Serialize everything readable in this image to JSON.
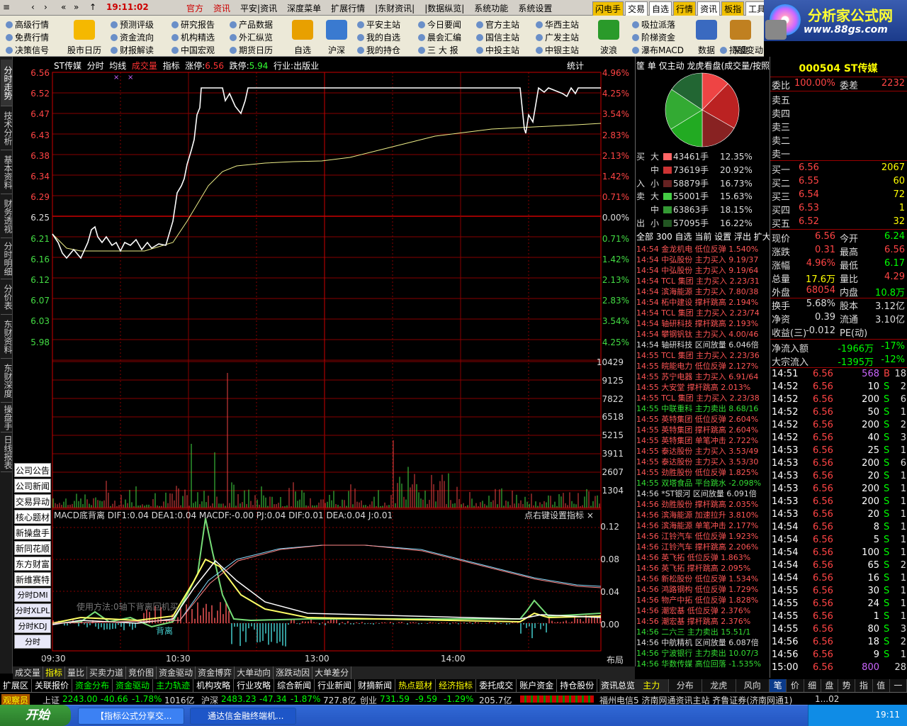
{
  "topbar": {
    "clock": "19:11:02",
    "menu": [
      "官方",
      "资讯",
      "平安|资讯",
      "深度菜单",
      "扩展行情",
      "|东财资讯|",
      "|数据纵览|",
      "系统功能",
      "系统设置"
    ],
    "quick": [
      "闪电手",
      "交易",
      "自选",
      "行情",
      "资讯",
      "板指",
      "工具"
    ]
  },
  "logo": {
    "line1": "分析家公式网",
    "line2": "www.88gs.com"
  },
  "toolbar": {
    "col1": [
      "高级行情",
      "免费行情",
      "决策信号"
    ],
    "big1": "股市日历",
    "col2": [
      "预测评级",
      "资金流向",
      "财报解读"
    ],
    "col3": [
      "研究报告",
      "机构精选",
      "中国宏观"
    ],
    "col4": [
      "产品数据",
      "外汇纵览",
      "期货日历"
    ],
    "big2": "自选",
    "big3": "沪深",
    "col5": [
      "平安主站",
      "我的自选",
      "我的持仓"
    ],
    "col6": [
      "今日要闻",
      "晨会汇编",
      "三 大 报"
    ],
    "col7": [
      "官方主站",
      "国信主站",
      "中投主站"
    ],
    "col8": [
      "华西主站",
      "广发主站",
      "中银主站"
    ],
    "big4": "波浪",
    "col9": [
      "吸拉派落",
      "阶梯资金",
      "瀑布MACD"
    ],
    "big5": "数据",
    "big6": "深度",
    "big7": "纵比",
    "col10": [
      "",
      "",
      "持股变动"
    ]
  },
  "lefttabs": [
    "分时走势",
    "技术分析",
    "基本资料",
    "财务透视",
    "分时明细",
    "分价表",
    "东财资料",
    "东财深度",
    "操盘手",
    "日线报表"
  ],
  "chart_title": {
    "name": "ST传媒",
    "tabs": [
      "分时",
      "均线",
      "成交量",
      "指标"
    ],
    "zt_label": "涨停:",
    "zt": "6.56",
    "dt_label": "跌停:",
    "dt": "5.94",
    "industry": "行业:出版业"
  },
  "stat_label": "统计",
  "price_axis": {
    "left": [
      "6.56",
      "6.52",
      "6.47",
      "6.43",
      "6.38",
      "6.34",
      "6.29",
      "6.25",
      "6.21",
      "6.16",
      "6.12",
      "6.07",
      "6.03",
      "5.98"
    ],
    "right": [
      "4.96%",
      "4.25%",
      "3.54%",
      "2.83%",
      "2.13%",
      "1.42%",
      "0.71%",
      "0.00%",
      "0.71%",
      "1.42%",
      "2.13%",
      "2.83%",
      "3.54%",
      "4.25%"
    ]
  },
  "vol_axis": [
    "10429",
    "9125",
    "7822",
    "6518",
    "5215",
    "3911",
    "2607",
    "1304"
  ],
  "macd_axis": [
    "0.12",
    "0.08",
    "0.04",
    "0.00"
  ],
  "left_buttons": [
    "公司公告",
    "公司新闻",
    "交易异动",
    "核心题材",
    "新操盘手",
    "新同花顺",
    "东方财富",
    "新维赛特",
    "分时DMI",
    "分时XLPL",
    "分时KDJ",
    "分时MACD"
  ],
  "macd": {
    "title": "MACD底背离  DIF1:0.04  DEA1:0.04  MACDF:-0.00  PJ:0.04  DIF:0.01  DEA:0.04  J:0.01",
    "hint": "点右键设置指标",
    "note": "使用方法:0轴下背离回机买",
    "tag": "背离"
  },
  "x_axis": [
    "09:30",
    "10:30",
    "13:00",
    "14:00"
  ],
  "bujuLabel": "布局",
  "bottom_tabs": [
    "成交量",
    "指标",
    "量比",
    "买卖力道",
    "竞价图",
    "资金驱动",
    "资金博弈",
    "大单动向",
    "涨跌动因",
    "大单差分"
  ],
  "tabs2": [
    "扩展区",
    "关联报价",
    "资金分布",
    "资金驱动",
    "主力轨迹",
    "机构攻略",
    "行业攻略",
    "综合新闻",
    "行业新闻",
    "财摘新闻",
    "热点题材",
    "经济指标",
    "委托成交",
    "账户资金",
    "持仓股份"
  ],
  "mid": {
    "head": "筐 单 仅主动 龙虎看盘(成交量/按照",
    "pie_colors": [
      "#d33",
      "#b22",
      "#822",
      "#2a2",
      "#3a3",
      "#263"
    ],
    "buy_rows": [
      {
        "g": "大",
        "v": "43461手",
        "p": "12.35%",
        "c": "#f66"
      },
      {
        "g": "中",
        "v": "73619手",
        "p": "20.92%",
        "c": "#c33"
      },
      {
        "g": "小",
        "v": "58879手",
        "p": "16.73%",
        "c": "#622"
      }
    ],
    "sell_rows": [
      {
        "g": "大",
        "v": "55001手",
        "p": "15.63%",
        "c": "#4c4"
      },
      {
        "g": "中",
        "v": "63863手",
        "p": "18.15%",
        "c": "#393"
      },
      {
        "g": "小",
        "v": "57095手",
        "p": "16.22%",
        "c": "#252"
      }
    ],
    "buy_label": [
      "买",
      "入"
    ],
    "sell_label": [
      "卖",
      "出"
    ],
    "flow_head": "全部 300 自选 当前 设置 浮出 扩大",
    "flow": [
      [
        "14:54",
        "金龙机电",
        "低位反弹",
        "1.540%",
        "r"
      ],
      [
        "14:54",
        "中弘股份",
        "主力买入",
        "9.19/37",
        "r"
      ],
      [
        "14:54",
        "中弘股份",
        "主力买入",
        "9.19/64",
        "r"
      ],
      [
        "14:54",
        "TCL 集团",
        "主力买入",
        "2.23/31",
        "r"
      ],
      [
        "14:54",
        "滨海能源",
        "主力买入",
        "7.80/38",
        "r"
      ],
      [
        "14:54",
        "柘中建设",
        "撑杆跳高",
        "2.194%",
        "r"
      ],
      [
        "14:54",
        "TCL 集团",
        "主力买入",
        "2.23/74",
        "r"
      ],
      [
        "14:54",
        "轴研科技",
        "撑杆跳高",
        "2.193%",
        "r"
      ],
      [
        "14:54",
        "攀钢钒钛",
        "主力买入",
        "4.00/46",
        "r"
      ],
      [
        "14:54",
        "轴研科技",
        "区间放量",
        "6.046倍",
        "w"
      ],
      [
        "14:55",
        "TCL 集团",
        "主力买入",
        "2.23/36",
        "r"
      ],
      [
        "14:55",
        "皖能电力",
        "低位反弹",
        "2.127%",
        "r"
      ],
      [
        "14:55",
        "苏宁电器",
        "主力买入",
        "6.91/64",
        "r"
      ],
      [
        "14:55",
        "大安堂",
        "撑杆跳高",
        "2.013%",
        "r"
      ],
      [
        "14:55",
        "TCL 集团",
        "主力买入",
        "2.23/38",
        "r"
      ],
      [
        "14:55",
        "中联重科",
        "主力卖出",
        "8.68/16",
        "g"
      ],
      [
        "14:55",
        "英特集团",
        "低位反弹",
        "2.604%",
        "r"
      ],
      [
        "14:55",
        "英特集团",
        "撑杆跳高",
        "2.604%",
        "r"
      ],
      [
        "14:55",
        "英特集团",
        "单笔冲击",
        "2.722%",
        "r"
      ],
      [
        "14:55",
        "泰达股份",
        "主力买入",
        "3.53/49",
        "r"
      ],
      [
        "14:55",
        "泰达股份",
        "主力买入",
        "3.53/30",
        "r"
      ],
      [
        "14:55",
        "劲胜股份",
        "低位反弹",
        "1.825%",
        "r"
      ],
      [
        "14:55",
        "双塔食品",
        "平台跳水",
        "-2.098%",
        "g"
      ],
      [
        "14:56",
        "*ST银河",
        "区间放量",
        "6.091倍",
        "w"
      ],
      [
        "14:56",
        "劲胜股份",
        "撑杆跳高",
        "2.035%",
        "r"
      ],
      [
        "14:56",
        "滨海能源",
        "加速拉升",
        "3.810%",
        "r"
      ],
      [
        "14:56",
        "滨海能源",
        "单笔冲击",
        "2.177%",
        "r"
      ],
      [
        "14:56",
        "江铃汽车",
        "低位反弹",
        "1.923%",
        "r"
      ],
      [
        "14:56",
        "江铃汽车",
        "撑杆跳高",
        "2.206%",
        "r"
      ],
      [
        "14:56",
        "英飞拓",
        "低位反弹",
        "1.863%",
        "r"
      ],
      [
        "14:56",
        "英飞拓",
        "撑杆跳高",
        "2.095%",
        "r"
      ],
      [
        "14:56",
        "新松股份",
        "低位反弹",
        "1.534%",
        "r"
      ],
      [
        "14:56",
        "鸿路钢构",
        "低位反弹",
        "1.729%",
        "r"
      ],
      [
        "14:56",
        "物产中拓",
        "低位反弹",
        "1.828%",
        "r"
      ],
      [
        "14:56",
        "潮宏基",
        "低位反弹",
        "2.376%",
        "r"
      ],
      [
        "14:56",
        "潮宏基",
        "撑杆跳高",
        "2.376%",
        "r"
      ],
      [
        "14:56",
        "二六三",
        "主力卖出",
        "15.51/1",
        "g"
      ],
      [
        "14:56",
        "中航精机",
        "区间放量",
        "6.087倍",
        "w"
      ],
      [
        "14:56",
        "宁波银行",
        "主力卖出",
        "10.07/3",
        "g"
      ],
      [
        "14:56",
        "华数传媒",
        "高位回落",
        "-1.535%",
        "g"
      ]
    ],
    "tabs": [
      "主力",
      "分布",
      "龙虎",
      "风向"
    ],
    "xunzong": "资讯总览"
  },
  "right": {
    "code": "000504 ST传媒",
    "wb": {
      "l1": "委比",
      "v1": "100.00%",
      "l2": "委差",
      "v2": "2232"
    },
    "sells": [
      "卖五",
      "卖四",
      "卖三",
      "卖二",
      "卖一"
    ],
    "buys": [
      {
        "l": "买一",
        "p": "6.56",
        "v": "2067"
      },
      {
        "l": "买二",
        "p": "6.55",
        "v": "60"
      },
      {
        "l": "买三",
        "p": "6.54",
        "v": "72"
      },
      {
        "l": "买四",
        "p": "6.53",
        "v": "1"
      },
      {
        "l": "买五",
        "p": "6.52",
        "v": "32"
      }
    ],
    "quote": [
      {
        "l": "现价",
        "v": "6.56",
        "c": "#f44",
        "l2": "今开",
        "v2": "6.24",
        "c2": "#0f0"
      },
      {
        "l": "涨跌",
        "v": "0.31",
        "c": "#f44",
        "l2": "最高",
        "v2": "6.56",
        "c2": "#f44"
      },
      {
        "l": "涨幅",
        "v": "4.96%",
        "c": "#f44",
        "l2": "最低",
        "v2": "6.17",
        "c2": "#0f0"
      },
      {
        "l": "总量",
        "v": "17.6万",
        "c": "#ff0",
        "l2": "量比",
        "v2": "4.29",
        "c2": "#f44"
      },
      {
        "l": "外盘",
        "v": "68054",
        "c": "#f44",
        "l2": "内盘",
        "v2": "10.8万",
        "c2": "#0f0"
      },
      {
        "l": "换手",
        "v": "5.68%",
        "c": "#ddd",
        "l2": "股本",
        "v2": "3.12亿",
        "c2": "#ddd"
      },
      {
        "l": "净资",
        "v": "0.39",
        "c": "#ddd",
        "l2": "流通",
        "v2": "3.10亿",
        "c2": "#ddd"
      },
      {
        "l": "收益(三)",
        "v": "-0.012",
        "c": "#ddd",
        "l2": "PE(动)",
        "v2": "",
        "c2": "#ddd"
      }
    ],
    "flow": [
      {
        "l": "净流入额",
        "v": "-1966万",
        "p": "-17%"
      },
      {
        "l": "大宗流入",
        "v": "-1395万",
        "p": "-12%"
      }
    ],
    "trades": [
      [
        "14:51",
        "6.56",
        "568",
        "B",
        "18",
        "#c6f"
      ],
      [
        "14:52",
        "6.56",
        "10",
        "S",
        "2",
        "#fff"
      ],
      [
        "14:52",
        "6.56",
        "200",
        "S",
        "6",
        "#fff"
      ],
      [
        "14:52",
        "6.56",
        "50",
        "S",
        "1",
        "#fff"
      ],
      [
        "14:52",
        "6.56",
        "200",
        "S",
        "2",
        "#fff"
      ],
      [
        "14:52",
        "6.56",
        "40",
        "S",
        "3",
        "#fff"
      ],
      [
        "14:53",
        "6.56",
        "25",
        "S",
        "1",
        "#fff"
      ],
      [
        "14:53",
        "6.56",
        "200",
        "S",
        "6",
        "#fff"
      ],
      [
        "14:53",
        "6.56",
        "20",
        "S",
        "1",
        "#fff"
      ],
      [
        "14:53",
        "6.56",
        "200",
        "S",
        "1",
        "#fff"
      ],
      [
        "14:53",
        "6.56",
        "200",
        "S",
        "1",
        "#fff"
      ],
      [
        "14:53",
        "6.56",
        "20",
        "S",
        "1",
        "#fff"
      ],
      [
        "14:54",
        "6.56",
        "8",
        "S",
        "1",
        "#fff"
      ],
      [
        "14:54",
        "6.56",
        "5",
        "S",
        "1",
        "#fff"
      ],
      [
        "14:54",
        "6.56",
        "100",
        "S",
        "1",
        "#fff"
      ],
      [
        "14:54",
        "6.56",
        "65",
        "S",
        "2",
        "#fff"
      ],
      [
        "14:54",
        "6.56",
        "16",
        "S",
        "1",
        "#fff"
      ],
      [
        "14:55",
        "6.56",
        "30",
        "S",
        "1",
        "#fff"
      ],
      [
        "14:55",
        "6.56",
        "24",
        "S",
        "1",
        "#fff"
      ],
      [
        "14:55",
        "6.56",
        "1",
        "S",
        "1",
        "#fff"
      ],
      [
        "14:55",
        "6.56",
        "80",
        "S",
        "3",
        "#fff"
      ],
      [
        "14:56",
        "6.56",
        "18",
        "S",
        "2",
        "#fff"
      ],
      [
        "14:56",
        "6.56",
        "9",
        "S",
        "1",
        "#fff"
      ],
      [
        "15:00",
        "6.56",
        "800",
        "",
        "28",
        "#c6f"
      ]
    ],
    "tabs": [
      "笔",
      "价",
      "细",
      "盘",
      "势",
      "指",
      "值",
      "一"
    ]
  },
  "status": {
    "user": "观察员",
    "sh": "上证",
    "sh_v": "2243.00",
    "sh_c": "-40.66",
    "sh_p": "-1.78%",
    "sh_a": "1016亿",
    "sz": "沪深",
    "sz_v": "2483.23",
    "sz_c": "-47.34",
    "sz_p": "-1.87%",
    "sz_a": "727.8亿",
    "cy": "创业",
    "cy_v": "731.59",
    "cy_c": "-9.59",
    "cy_p": "-1.29%",
    "cy_a": "205.7亿",
    "server": "福州电信5 济南网通资讯主站 齐鲁证券(济南网通1)",
    "time": "1...02"
  },
  "taskbar": {
    "start": "开始",
    "t1": "【指标公式分享交...",
    "t2": "通达信金融终端机...",
    "clock": "19:11"
  }
}
